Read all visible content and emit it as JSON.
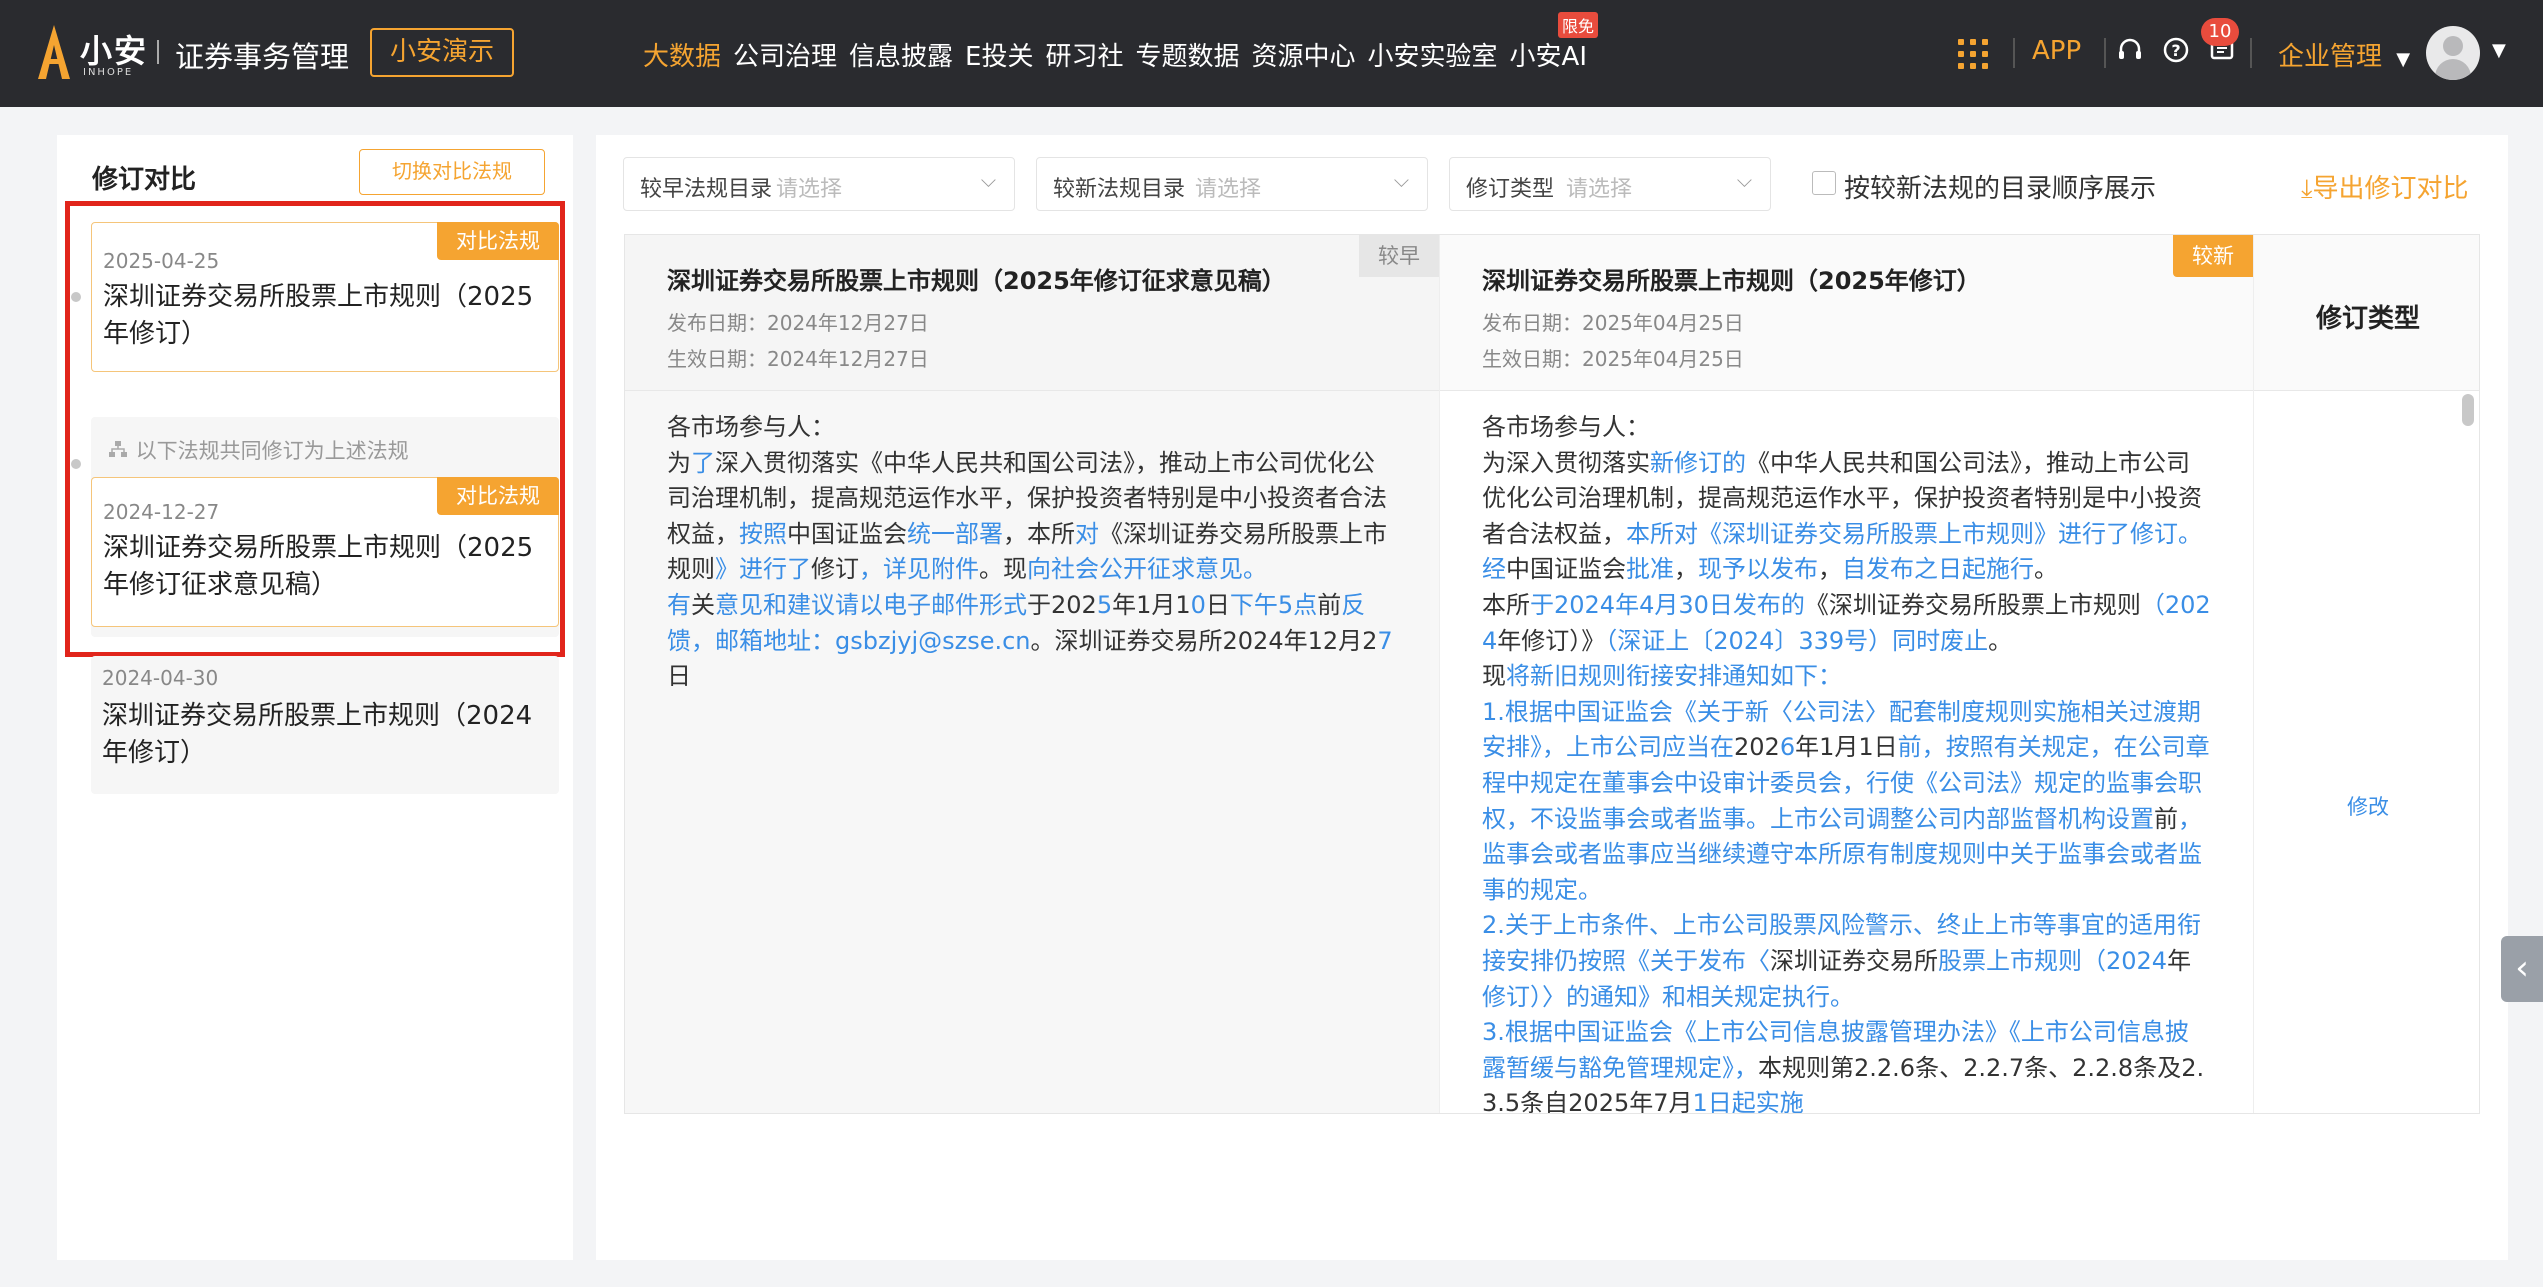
{
  "topbar": {
    "logo_cn": "小安",
    "logo_en": "INHOPE",
    "app_title": "证券事务管理",
    "demo_button": "小安演示",
    "nav": [
      {
        "label": "大数据",
        "active": true
      },
      {
        "label": "公司治理",
        "active": false
      },
      {
        "label": "信息披露",
        "active": false
      },
      {
        "label": "E投关",
        "active": false
      },
      {
        "label": "研习社",
        "active": false
      },
      {
        "label": "专题数据",
        "active": false
      },
      {
        "label": "资源中心",
        "active": false
      },
      {
        "label": "小安实验室",
        "active": false
      },
      {
        "label": "小安AI",
        "active": false
      }
    ],
    "nav_badge": "限免",
    "app_link": "APP",
    "message_count": "10",
    "enterprise_menu": "企业管理",
    "accent_color": "#f5a431"
  },
  "left": {
    "title": "修订对比",
    "switch_button": "切换对比法规",
    "group_note": "以下法规共同修订为上述法规",
    "cards": [
      {
        "date": "2025-04-25",
        "name": "深圳证券交易所股票上市规则（2025年修订）",
        "flag": "对比法规"
      },
      {
        "date": "2024-12-27",
        "name": "深圳证券交易所股票上市规则（2025年修订征求意见稿）",
        "flag": "对比法规"
      },
      {
        "date": "2024-04-30",
        "name": "深圳证券交易所股票上市规则（2024年修订）"
      }
    ]
  },
  "filters": {
    "earlier_label": "较早法规目录",
    "earlier_placeholder": "请选择",
    "newer_label": "较新法规目录",
    "newer_placeholder": "请选择",
    "type_label": "修订类型",
    "type_placeholder": "请选择",
    "order_checkbox_label": "按较新法规的目录顺序展示",
    "export_label": "导出修订对比"
  },
  "table": {
    "earlier": {
      "tag": "较早",
      "title": "深圳证券交易所股票上市规则（2025年修订征求意见稿）",
      "publish_date": "发布日期：2024年12月27日",
      "effective_date": "生效日期：2024年12月27日",
      "segments": [
        [
          "各市场参与人：",
          false
        ],
        [
          "\n",
          false
        ],
        [
          "为",
          false
        ],
        [
          "了",
          true
        ],
        [
          "深入贯彻落实《中华人民共和国公司法》，推动上市公司优化公司治理机制，提高规范运作水平，保护投资者特别是中小投资者合法权益，",
          false
        ],
        [
          "按照",
          true
        ],
        [
          "中国证监会",
          false
        ],
        [
          "统一部署",
          true
        ],
        [
          "，本所",
          false
        ],
        [
          "对",
          true
        ],
        [
          "《深圳证券交易所股票上市规则",
          false
        ],
        [
          "》进行了",
          true
        ],
        [
          "修订",
          false
        ],
        [
          "，详见附件",
          true
        ],
        [
          "。现",
          false
        ],
        [
          "向社会公开征求意见。",
          true
        ],
        [
          "\n",
          false
        ],
        [
          "有",
          true
        ],
        [
          "关",
          false
        ],
        [
          "意见和建议请以电子邮件形式",
          true
        ],
        [
          "于202",
          false
        ],
        [
          "5",
          true
        ],
        [
          "年1月1",
          false
        ],
        [
          "0",
          true
        ],
        [
          "日",
          false
        ],
        [
          "下午5点",
          true
        ],
        [
          "前",
          false
        ],
        [
          "反馈，邮箱地址：gsbzjyj@szse.cn",
          true
        ],
        [
          "。深圳证券交易所2024年12月2",
          false
        ],
        [
          "7",
          true
        ],
        [
          "日",
          false
        ]
      ]
    },
    "newer": {
      "tag": "较新",
      "title": "深圳证券交易所股票上市规则（2025年修订）",
      "publish_date": "发布日期：2025年04月25日",
      "effective_date": "生效日期：2025年04月25日",
      "segments": [
        [
          "各市场参与人：",
          false
        ],
        [
          "\n",
          false
        ],
        [
          "为深入贯彻落实",
          false
        ],
        [
          "新修订的",
          true
        ],
        [
          "《中华人民共和国公司法》，推动上市公司优化公司治理机制，提高规范运作水平，保护投资者特别是中小投资者合法权益，",
          false
        ],
        [
          "本所对《深圳证券交易所股票上市规则》进行了修订。经",
          true
        ],
        [
          "中国证监会",
          false
        ],
        [
          "批准",
          true
        ],
        [
          "，",
          false
        ],
        [
          "现予以发布",
          true
        ],
        [
          "，",
          false
        ],
        [
          "自发布之日起施行",
          true
        ],
        [
          "。",
          false
        ],
        [
          "\n",
          false
        ],
        [
          "本所",
          false
        ],
        [
          "于2024年4月30日发布的",
          true
        ],
        [
          "《深圳证券交易所股票上市规则",
          false
        ],
        [
          "（2024",
          true
        ],
        [
          "年修订）》",
          false
        ],
        [
          "（深证上〔2024〕339号）同时废止",
          true
        ],
        [
          "。",
          false
        ],
        [
          "\n",
          false
        ],
        [
          "现",
          false
        ],
        [
          "将新旧规则衔接安排通知如下：",
          true
        ],
        [
          "\n",
          false
        ],
        [
          "1.根据中国证监会《关于",
          true
        ],
        [
          "新〈公司法〉配套制度规则实施相关过渡期安排》，上市公司应当在",
          true
        ],
        [
          "202",
          false
        ],
        [
          "6",
          true
        ],
        [
          "年1月1日",
          false
        ],
        [
          "前，按照有关规定，在公司章程中规定在董事会中设审计委员会，行使《公司法》规定的监事会职权，不设监事会或者监事。上市公司调整公司内部监督机构设置",
          true
        ],
        [
          "前",
          false
        ],
        [
          "，监事会或者监事应当继续遵守本所原有制度规则中关于监事会或者监事的规定。",
          true
        ],
        [
          "\n",
          false
        ],
        [
          "2.关于上市条件、上市公司股票风险警示、终止上市等事宜的适用衔接安排仍按照《关于发布〈",
          true
        ],
        [
          "深圳证券交易所",
          false
        ],
        [
          "股票上市规则（2024",
          true
        ],
        [
          "年",
          false
        ],
        [
          "修订）〉的通知》和相关规定执行。",
          true
        ],
        [
          "\n",
          false
        ],
        [
          "3.根据中国证监会《上市公司信息披露管理办法》《上市公司信息披露暂缓与豁免管理规定》，",
          true
        ],
        [
          "本规则第2.2.6条、2.2.7条、2.2.8条及2.3.5条自2025年7月",
          false
        ],
        [
          "1日起实施",
          true
        ]
      ]
    },
    "type_header": "修订类型",
    "type_value": "修改"
  }
}
